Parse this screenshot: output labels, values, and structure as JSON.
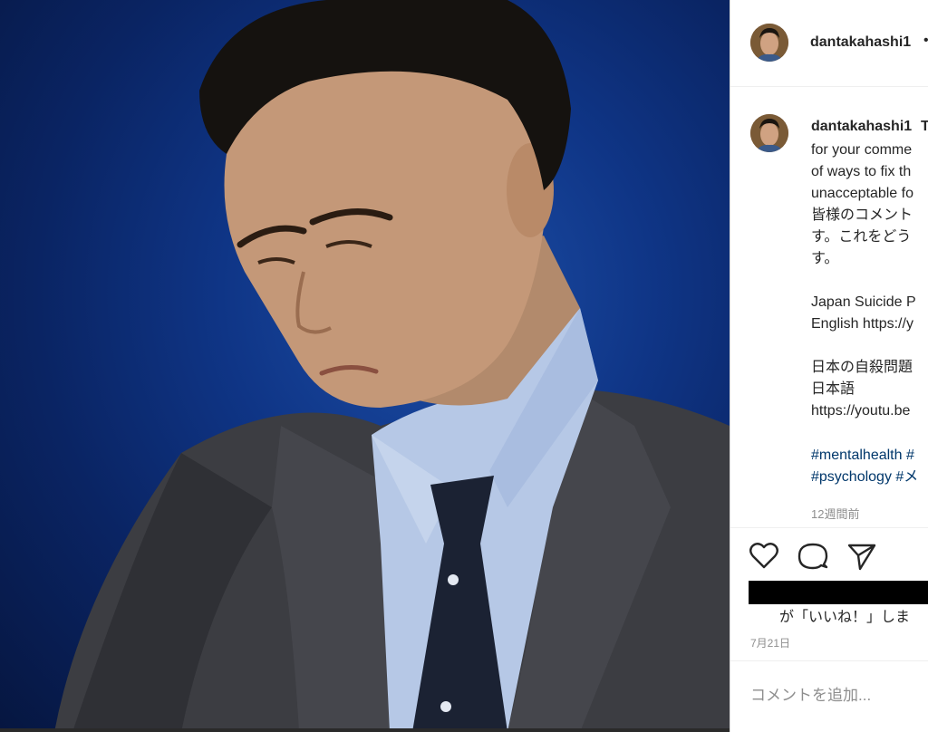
{
  "post": {
    "username": "dantakahashi1",
    "header_dot": "•",
    "caption_continuation": "T",
    "caption_lines": [
      "for your comme",
      "of ways to fix th",
      "unacceptable fo",
      "皆様のコメント",
      "す。これをどう",
      "す。",
      "",
      "Japan Suicide P",
      "English https://y",
      "",
      "日本の自殺問題",
      "日本語",
      "https://youtu.be"
    ],
    "hashtag_lines": [
      "#mentalhealth #",
      "#psychology #メ"
    ],
    "time_ago": "12週間前"
  },
  "actions": {
    "like_icon": "heart-icon",
    "comment_icon": "comment-bubble-icon",
    "share_icon": "paper-plane-icon"
  },
  "likes_text": "が「いいね！」しま",
  "post_date": "7月21日",
  "comment_box": {
    "placeholder": "コメントを追加..."
  },
  "colors": {
    "background_blue": "#0f3586",
    "hashtag": "#00376b",
    "muted_text": "#8e8e8e",
    "border": "#dbdbdb"
  }
}
